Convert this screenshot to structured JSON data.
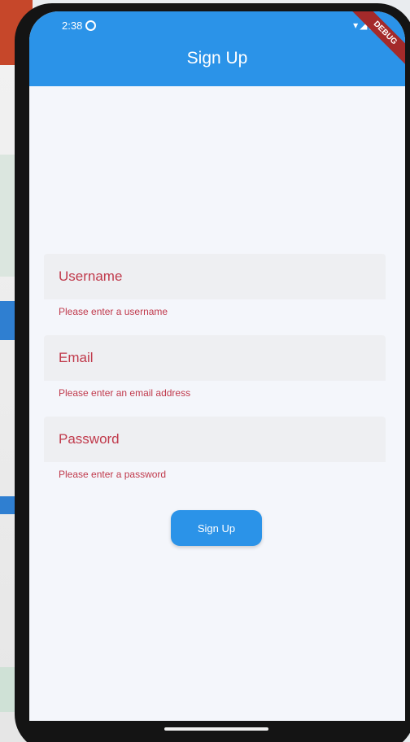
{
  "status_bar": {
    "time": "2:38",
    "signal_icons": "▾◢▮"
  },
  "debug_banner": "DEBUG",
  "app_bar": {
    "title": "Sign Up"
  },
  "form": {
    "fields": [
      {
        "label": "Username",
        "error": "Please enter a username"
      },
      {
        "label": "Email",
        "error": "Please enter an email address"
      },
      {
        "label": "Password",
        "error": "Please enter a password"
      }
    ],
    "submit_label": "Sign Up"
  },
  "colors": {
    "primary": "#2b93e8",
    "error": "#c0394b",
    "background": "#f4f6fb"
  }
}
